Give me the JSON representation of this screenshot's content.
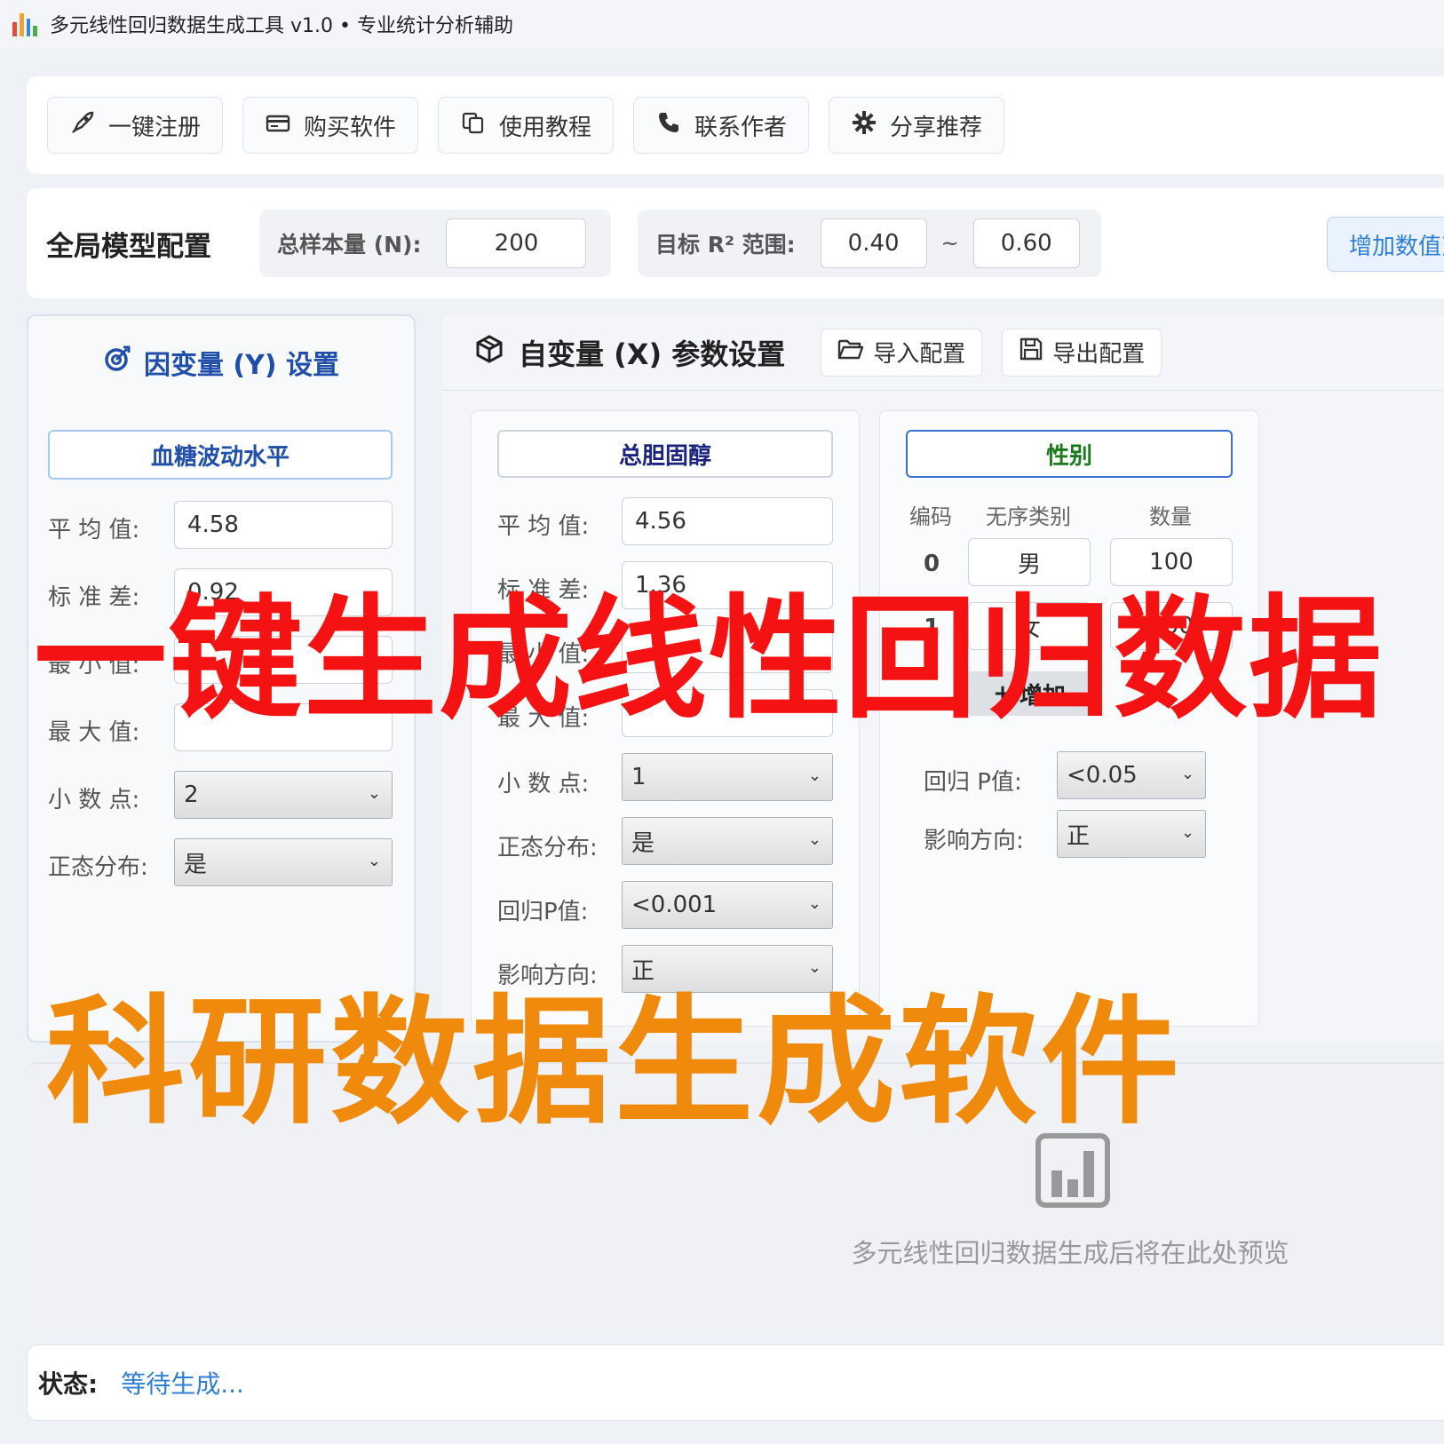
{
  "window": {
    "title": "多元线性回归数据生成工具 v1.0 • 专业统计分析辅助"
  },
  "toolbar": {
    "register": "一键注册",
    "buy": "购买软件",
    "tutorial": "使用教程",
    "contact": "联系作者",
    "share": "分享推荐"
  },
  "global": {
    "title": "全局模型配置",
    "n_label": "总样本量 (N):",
    "n_value": "200",
    "r2_label": "目标 R² 范围:",
    "r2_min": "0.40",
    "r2_sep": "~",
    "r2_max": "0.60",
    "add_var": "增加数值变量"
  },
  "y": {
    "title": "因变量 (Y) 设置",
    "name": "血糖波动水平",
    "mean_label": "平 均 值:",
    "mean": "4.58",
    "sd_label": "标 准 差:",
    "sd": "0.92",
    "min_label": "最 小 值:",
    "min": "",
    "max_label": "最 大 值:",
    "max": "",
    "decimals_label": "小 数 点:",
    "decimals": "2",
    "normal_label": "正态分布:",
    "normal": "是"
  },
  "x": {
    "title": "自变量 (X) 参数设置",
    "import": "导入配置",
    "export": "导出配置",
    "var1": {
      "name": "总胆固醇",
      "mean_label": "平 均 值:",
      "mean": "4.56",
      "sd_label": "标 准 差:",
      "sd": "1.36",
      "min_label": "最 小 值:",
      "min": "",
      "max_label": "最 大 值:",
      "max": "",
      "decimals_label": "小 数 点:",
      "decimals": "1",
      "normal_label": "正态分布:",
      "normal": "是",
      "p_label": "回归P值:",
      "p": "<0.001",
      "direction_label": "影响方向:",
      "direction": "正"
    },
    "var2": {
      "name": "性别",
      "col_code": "编码",
      "col_category": "无序类别",
      "col_count": "数量",
      "rows": [
        {
          "code": "0",
          "category": "男",
          "count": "100"
        },
        {
          "code": "1",
          "category": "女",
          "count": "100"
        }
      ],
      "add_label": "增加",
      "p_label": "回归 P值:",
      "p": "<0.05",
      "direction_label": "影响方向:",
      "direction": "正"
    }
  },
  "preview": {
    "text": "多元线性回归数据生成后将在此处预览"
  },
  "status": {
    "label": "状态:",
    "value": "等待生成..."
  },
  "overlay": {
    "headline": "一键生成线性回归数据",
    "subline": "科研数据生成软件"
  },
  "colors": {
    "y_title": "#1f4fa8",
    "var1_name": "#1a237e",
    "var2_name": "#1b7a1b",
    "accent": "#2f7fd6",
    "overlay_red": "#f51212",
    "overlay_orange": "#ef8a0c"
  },
  "icons": {
    "app": "bar-chart-icon",
    "register": "rocket-icon",
    "buy": "credit-card-icon",
    "tutorial": "copy-icon",
    "contact": "phone-icon",
    "share": "gear-icon",
    "y_title": "target-icon",
    "x_title": "cube-icon",
    "import": "folder-open-icon",
    "export": "save-icon",
    "preview": "chart-icon"
  }
}
